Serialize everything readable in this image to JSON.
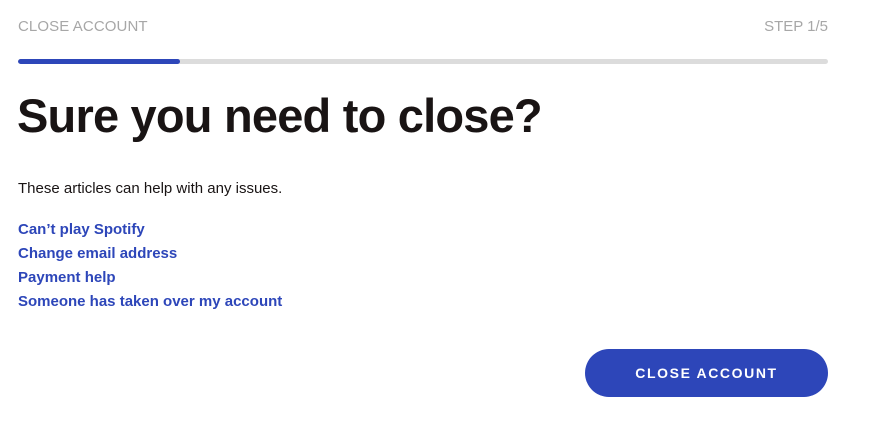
{
  "header": {
    "flow_title": "CLOSE ACCOUNT",
    "step": "STEP 1/5"
  },
  "progress": {
    "fraction": 0.2,
    "color": "#2d46b9",
    "track_color": "#dcdcdc"
  },
  "main": {
    "heading": "Sure you need to close?",
    "intro": "These articles can help with any issues.",
    "articles": [
      {
        "label": "Can’t play Spotify"
      },
      {
        "label": "Change email address"
      },
      {
        "label": "Payment help"
      },
      {
        "label": "Someone has taken over my account"
      }
    ]
  },
  "actions": {
    "close_account_label": "CLOSE ACCOUNT"
  },
  "colors": {
    "accent": "#2d46b9",
    "text": "#191414",
    "muted": "#a7a7a7"
  }
}
